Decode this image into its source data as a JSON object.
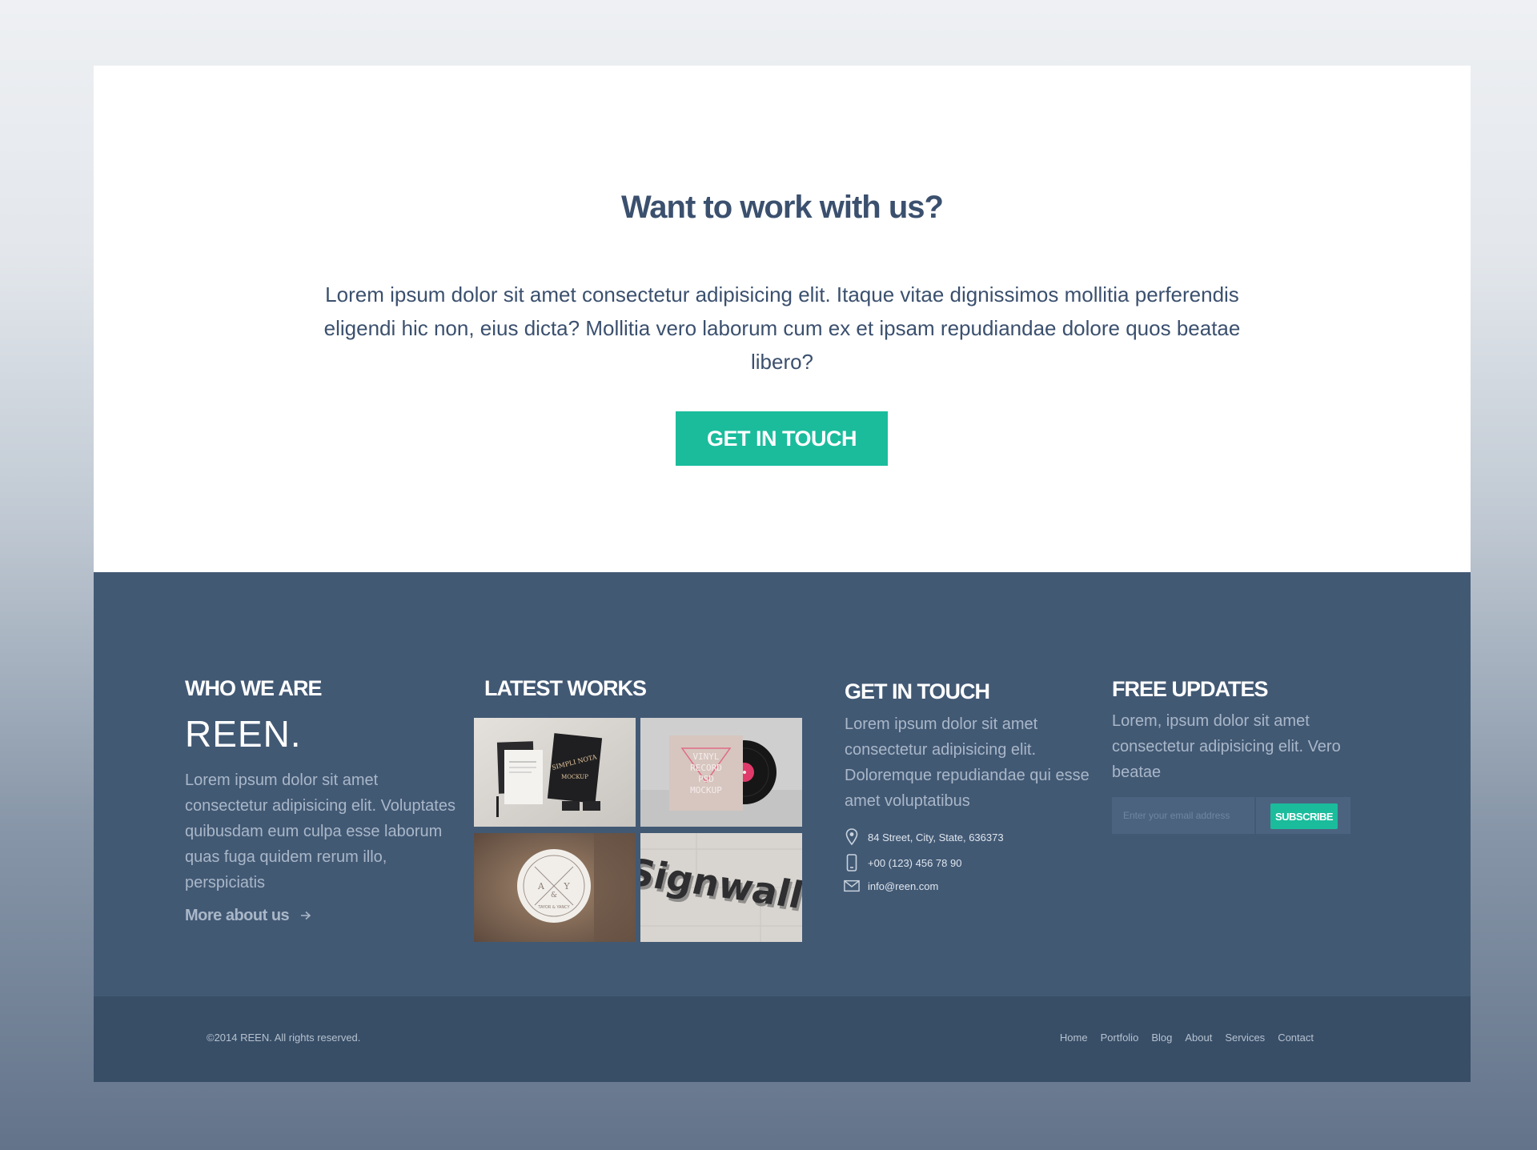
{
  "cta": {
    "title": "Want to work with us?",
    "text": "Lorem ipsum dolor sit amet consectetur adipisicing elit. Itaque vitae dignissimos mollitia perferendis eligendi hic non, eius dicta? Mollitia vero laborum cum ex et ipsam repudiandae dolore quos beatae libero?",
    "button_label": "GET IN TOUCH"
  },
  "footer": {
    "who": {
      "heading": "WHO WE ARE",
      "brand": "REEN.",
      "text": "Lorem ipsum dolor sit amet consectetur adipisicing elit. Voluptates quibusdam eum culpa esse laborum quas fuga quidem rerum illo, perspiciatis",
      "link_label": "More about us",
      "link_icon": "arrow-right-icon"
    },
    "works": {
      "heading": "LATEST WORKS",
      "items": [
        {
          "name": "stationery-mockup",
          "lines": [
            "SIMPLI NOTA",
            "MOCKUP"
          ]
        },
        {
          "name": "vinyl-mockup",
          "lines": [
            "VINYL",
            "RECORD",
            "PSD",
            "MOCKUP"
          ]
        },
        {
          "name": "badge-mockup",
          "lines": [
            "A",
            "Y",
            "&",
            "TAYOR & YANCY"
          ]
        },
        {
          "name": "signwall-mockup",
          "lines": [
            "Signwall"
          ]
        }
      ]
    },
    "contact": {
      "heading": "GET IN TOUCH",
      "text": "Lorem ipsum dolor sit amet consectetur adipisicing elit. Doloremque repudiandae qui esse amet voluptatibus",
      "address": "84 Street, City, State, 636373",
      "phone": "+00 (123) 456 78 90",
      "email": "info@reen.com",
      "icons": [
        "location-pin-icon",
        "mobile-phone-icon",
        "envelope-icon"
      ]
    },
    "updates": {
      "heading": "FREE UPDATES",
      "text": "Lorem, ipsum dolor sit amet consectetur adipisicing elit. Vero beatae",
      "email_placeholder": "Enter your email address",
      "subscribe_label": "SUBSCRIBE"
    }
  },
  "bottom": {
    "copyright": "©2014 REEN. All rights reserved.",
    "nav": [
      "Home",
      "Portfolio",
      "Blog",
      "About",
      "Services",
      "Contact"
    ]
  },
  "colors": {
    "accent": "#1abc9c",
    "footer_bg": "#425974",
    "bottom_bar_bg": "#384e67",
    "heading_text": "#3b506e"
  }
}
